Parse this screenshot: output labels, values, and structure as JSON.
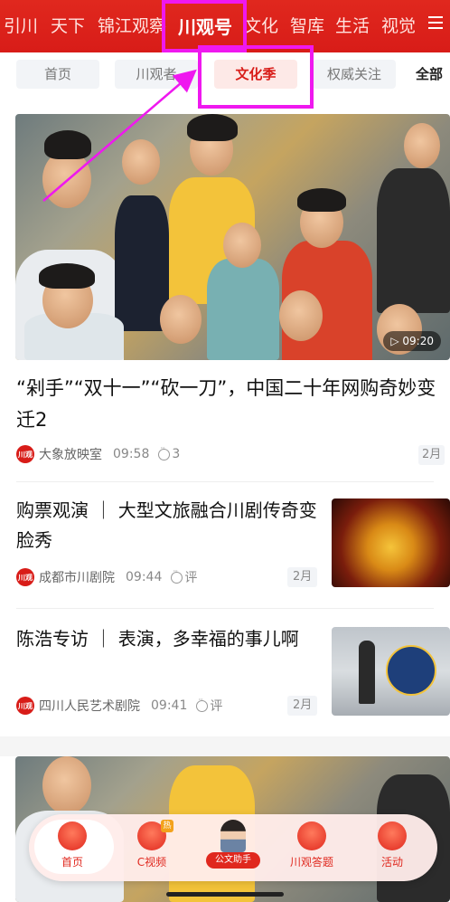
{
  "channels": [
    {
      "label": "引川"
    },
    {
      "label": "天下"
    },
    {
      "label": "锦江观察"
    },
    {
      "label": "川观号",
      "active": true
    },
    {
      "label": "文化"
    },
    {
      "label": "智库"
    },
    {
      "label": "生活"
    },
    {
      "label": "视觉"
    }
  ],
  "subtabs": [
    {
      "label": "首页"
    },
    {
      "label": "川观者"
    },
    {
      "label": "文化季",
      "active": true
    },
    {
      "label": "权威关注"
    },
    {
      "label": "全部"
    }
  ],
  "feature": {
    "duration": "09:20",
    "title": "“剁手”“双十一”“砍一刀”，中国二十年网购奇妙变迁2",
    "logo_text": "川观",
    "source": "大象放映室",
    "time": "09:58",
    "comments": "3",
    "tag": "2月"
  },
  "items": [
    {
      "title": "购票观演 ｜ 大型文旅融合川剧传奇变脸秀",
      "logo_text": "川观",
      "source": "成都市川剧院",
      "time": "09:44",
      "comments": "评",
      "tag": "2月"
    },
    {
      "title": "陈浩专访 ｜ 表演，多幸福的事儿啊",
      "logo_text": "川观",
      "source": "四川人民艺术剧院",
      "time": "09:41",
      "comments": "评",
      "tag": "2月"
    }
  ],
  "bottom_nav": [
    {
      "label": "首页",
      "active": true
    },
    {
      "label": "C视频",
      "badge": "热"
    },
    {
      "label": "公文助手"
    },
    {
      "label": "川观答题"
    },
    {
      "label": "活动"
    }
  ],
  "colors": {
    "brand": "#d81c18",
    "annotation": "#ef18ef"
  },
  "icons": [
    "menu-icon",
    "play-icon",
    "comment-icon",
    "home-icon",
    "video-icon",
    "assistant-avatar-icon",
    "quiz-icon",
    "activity-icon"
  ]
}
